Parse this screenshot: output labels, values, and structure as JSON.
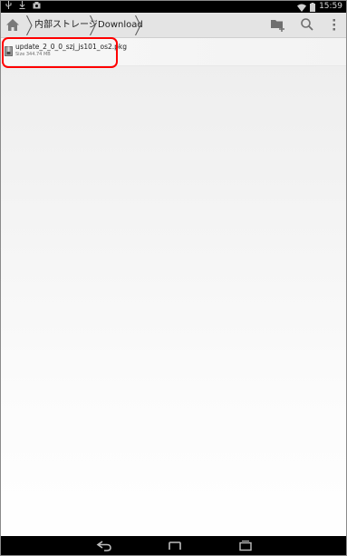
{
  "status_bar": {
    "time": "15:59",
    "left_icons": [
      "usb-icon",
      "download-icon",
      "photo-icon"
    ],
    "right_icons": [
      "wifi-icon",
      "battery-icon"
    ]
  },
  "action_bar": {
    "home_icon": "home-icon",
    "breadcrumbs": [
      "内部ストレージ",
      "Download"
    ],
    "actions": [
      "new-folder-icon",
      "search-icon",
      "overflow-menu-icon"
    ]
  },
  "files": [
    {
      "name": "update_2_0_0_szj_js101_os2.pkg",
      "size": "Size 344.74 MB",
      "icon": "archive-file-icon"
    }
  ],
  "highlight": {
    "color": "#ff0000"
  },
  "navigation_bar": {
    "buttons": [
      "back-icon",
      "home-icon",
      "recents-icon"
    ]
  }
}
